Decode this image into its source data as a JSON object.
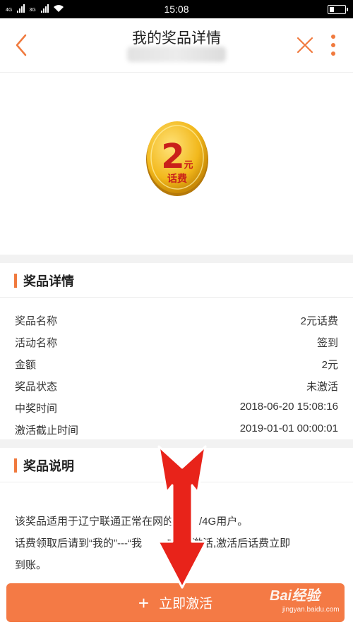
{
  "status_bar": {
    "network": "4G",
    "network2": "3G",
    "time": "15:08"
  },
  "header": {
    "title": "我的奖品详情"
  },
  "prize": {
    "coin_amount": "2",
    "coin_unit": "元",
    "coin_label": "话费"
  },
  "details": {
    "title": "奖品详情",
    "rows": [
      {
        "label": "奖品名称",
        "value": "2元话费"
      },
      {
        "label": "活动名称",
        "value": "签到"
      },
      {
        "label": "金额",
        "value": "2元"
      },
      {
        "label": "奖品状态",
        "value": "未激活"
      },
      {
        "label": "中奖时间",
        "value": "2018-06-20 15:08:16"
      },
      {
        "label": "激活截止时间",
        "value": "2019-01-01 00:00:01"
      }
    ]
  },
  "description": {
    "title": "奖品说明",
    "line1": "该奖品适用于辽宁联通正常在网的",
    "line1_end": "/4G用户。",
    "line2": "话费领取后请到“我的”---“我",
    "line2_end": "”页面激活,激活后话费立即",
    "line3": "到账。"
  },
  "action": {
    "activate_label": "立即激活"
  },
  "watermark": {
    "logo_text": "Bai经验",
    "url": "jingyan.baidu.com"
  },
  "colors": {
    "accent": "#f47a45",
    "arrow": "#e8231a",
    "coin": "#f2b81c"
  }
}
